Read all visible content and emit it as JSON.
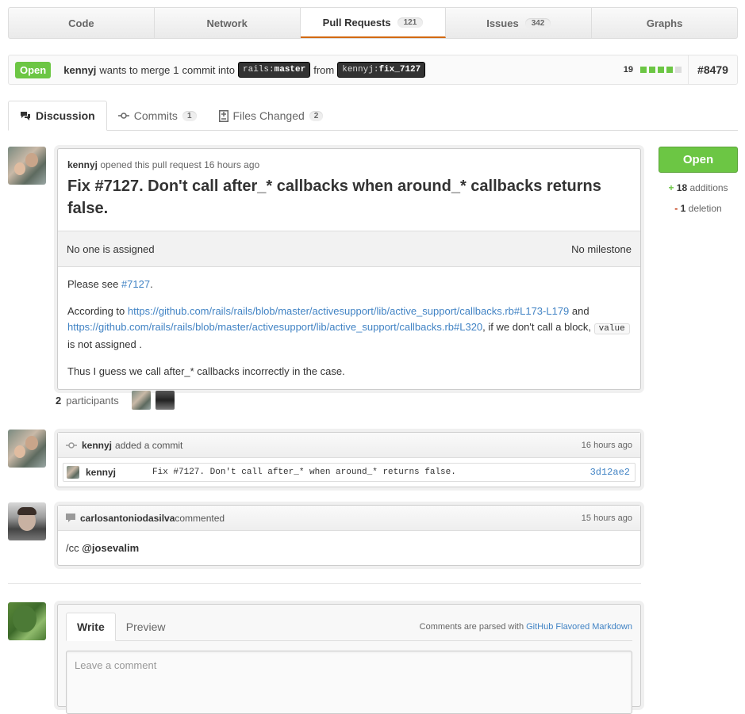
{
  "repo_nav": {
    "tabs": [
      {
        "label": "Code"
      },
      {
        "label": "Network"
      },
      {
        "label": "Pull Requests",
        "count": "121"
      },
      {
        "label": "Issues",
        "count": "342"
      },
      {
        "label": "Graphs"
      }
    ]
  },
  "pr_header": {
    "state": "Open",
    "author": "kennyj",
    "text_wants": "wants to merge",
    "commit_count": "1",
    "text_commit_into": "commit into",
    "base_repo": "rails",
    "base_branch": "master",
    "text_from": "from",
    "head_repo": "kennyj",
    "head_branch": "fix_7127",
    "diffstat_count": "19",
    "number": "#8479"
  },
  "tabs": {
    "discussion": "Discussion",
    "commits": "Commits",
    "commits_count": "1",
    "files": "Files Changed",
    "files_count": "2"
  },
  "pull": {
    "author": "kennyj",
    "opened_text": "opened this pull request 16 hours ago",
    "title": "Fix #7127. Don't call after_* callbacks when around_* callbacks returns false.",
    "assignee": "No one is assigned",
    "milestone": "No milestone",
    "body": {
      "p1_prefix": "Please see",
      "p1_link": "#7127",
      "p1_suffix": ".",
      "p2_prefix": "According to",
      "p2_link1": "https://github.com/rails/rails/blob/master/activesupport/lib/active_support/callbacks.rb#L173-L179",
      "p2_and": "and",
      "p2_link2": "https://github.com/rails/rails/blob/master/activesupport/lib/active_support/callbacks.rb#L320",
      "p2_mid": ", if we don't call a block,",
      "p2_code": "value",
      "p2_suffix": "is not assigned .",
      "p3": "Thus I guess we call after_* callbacks incorrectly in the case."
    }
  },
  "sidebar": {
    "state_button": "Open",
    "additions_sign": "+",
    "additions": "18",
    "additions_label": "additions",
    "deletions_sign": "-",
    "deletions": "1",
    "deletions_label": "deletion"
  },
  "participants": {
    "count": "2",
    "label": "participants"
  },
  "commit_event": {
    "author": "kennyj",
    "action": "added a commit",
    "time": "16 hours ago",
    "commit_author": "kennyj",
    "message": "Fix #7127. Don't call after_* when around_* returns false.",
    "sha": "3d12ae2"
  },
  "comment_event": {
    "author": "carlosantoniodasilva",
    "action": "commented",
    "time": "15 hours ago",
    "body_prefix": "/cc",
    "mention": "@josevalim"
  },
  "write": {
    "tab_write": "Write",
    "tab_preview": "Preview",
    "hint_prefix": "Comments are parsed with",
    "hint_link": "GitHub Flavored Markdown",
    "placeholder": "Leave a comment"
  },
  "colors": {
    "open_green": "#6cc644",
    "link_blue": "#4183c4",
    "tab_accent": "#d26911"
  }
}
